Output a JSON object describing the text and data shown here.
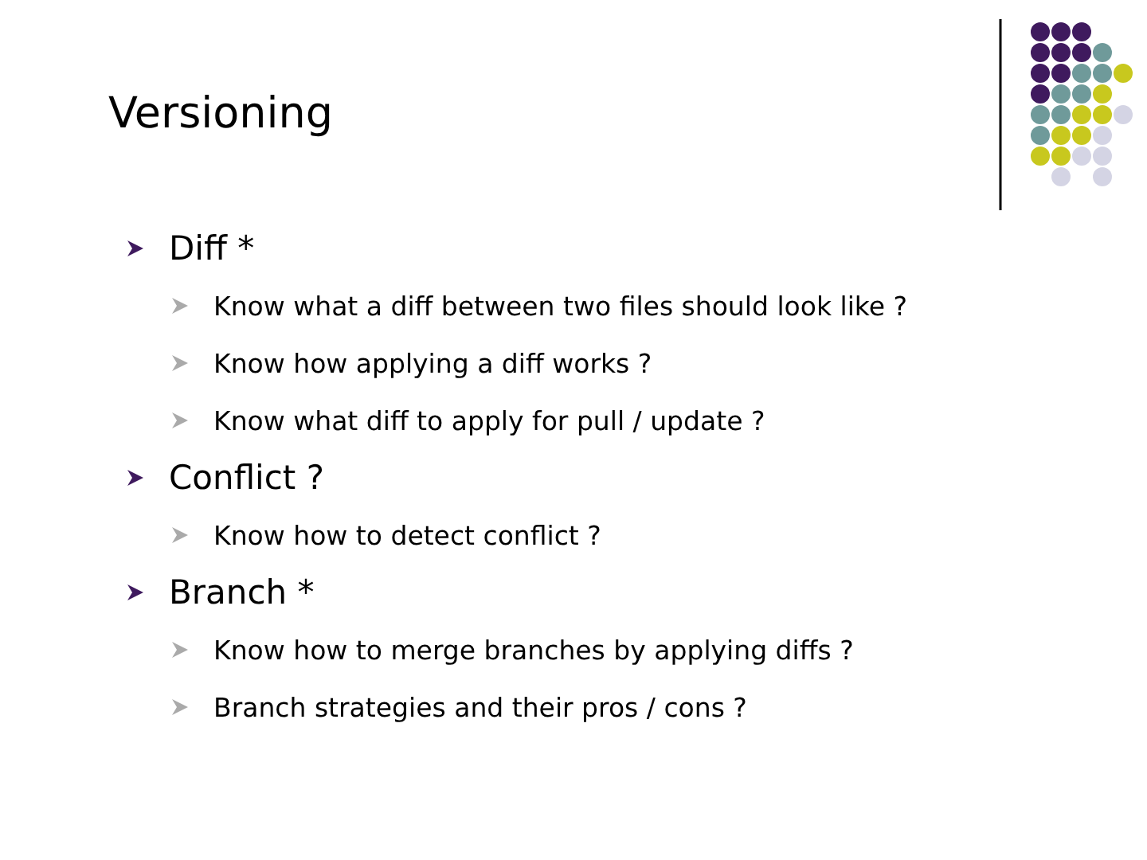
{
  "slide": {
    "title": "Versioning",
    "bullets": [
      {
        "text": "Diff *",
        "children": [
          {
            "text": "Know what a diff between two files should look like ?"
          },
          {
            "text": "Know how applying a diff works ?"
          },
          {
            "text": "Know what diff to apply for pull / update ?"
          }
        ]
      },
      {
        "text": "Conflict ?",
        "children": [
          {
            "text": "Know how to detect conflict ?"
          }
        ]
      },
      {
        "text": "Branch *",
        "children": [
          {
            "text": "Know how to merge branches by applying diffs ?"
          },
          {
            "text": "Branch strategies and their pros / cons ?"
          }
        ]
      }
    ]
  }
}
